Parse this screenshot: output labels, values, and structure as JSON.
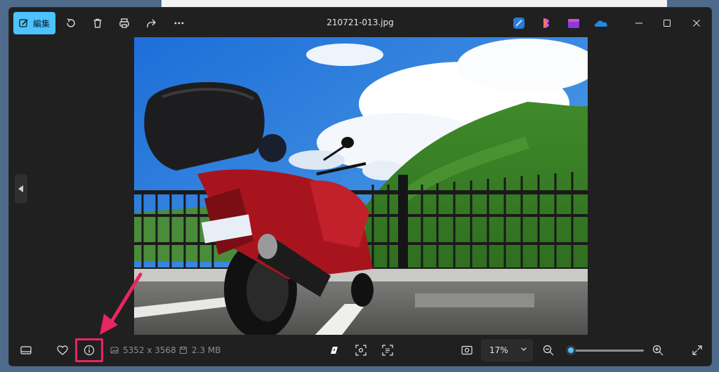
{
  "window": {
    "title": "210721-013.jpg",
    "edit_label": "編集"
  },
  "toolbar": {
    "icons": [
      "edit-icon",
      "rotate-icon",
      "delete-icon",
      "print-icon",
      "share-icon",
      "more-icon"
    ]
  },
  "apps": [
    "designer-icon",
    "clipchamp-icon",
    "clipchamp-video-icon",
    "onedrive-icon"
  ],
  "window_controls": [
    "minimize-icon",
    "maximize-icon",
    "close-icon"
  ],
  "status": {
    "dimensions": "5352 x 3568",
    "file_size": "2.3 MB"
  },
  "zoom": {
    "level_label": "17%",
    "slider_fraction": 0.04
  },
  "colors": {
    "accent": "#4cc2ff",
    "highlight": "#e8265e",
    "window_bg": "#202020"
  }
}
